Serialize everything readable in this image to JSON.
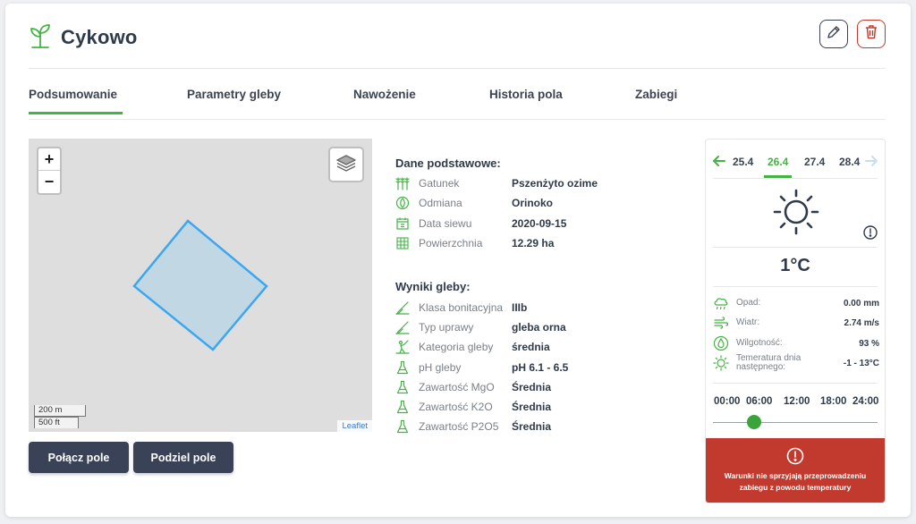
{
  "header": {
    "title": "Cykowo",
    "logo_icon": "sprout-icon"
  },
  "actions": {
    "edit_icon": "pencil-icon",
    "delete_icon": "trash-icon"
  },
  "tabs": [
    {
      "label": "Podsumowanie",
      "active": true
    },
    {
      "label": "Parametry gleby",
      "active": false
    },
    {
      "label": "Nawożenie",
      "active": false
    },
    {
      "label": "Historia pola",
      "active": false
    },
    {
      "label": "Zabiegi",
      "active": false
    }
  ],
  "map": {
    "zoom_in": "+",
    "zoom_out": "−",
    "scale_metric": "200 m",
    "scale_imperial": "500 ft",
    "attribution": "Leaflet"
  },
  "buttons": {
    "merge": "Połącz pole",
    "split": "Podziel pole"
  },
  "basic": {
    "title": "Dane podstawowe:",
    "rows": [
      {
        "label": "Gatunek",
        "value": "Pszenżyto ozime",
        "icon": "wheat-icon"
      },
      {
        "label": "Odmiana",
        "value": "Orinoko",
        "icon": "seed-icon"
      },
      {
        "label": "Data siewu",
        "value": "2020-09-15",
        "icon": "calendar-icon"
      },
      {
        "label": "Powierzchnia",
        "value": "12.29 ha",
        "icon": "area-grid-icon"
      }
    ]
  },
  "soil": {
    "title": "Wyniki gleby:",
    "rows": [
      {
        "label": "Klasa bonitacyjna",
        "value": "IIIb",
        "icon": "shovel-icon"
      },
      {
        "label": "Typ uprawy",
        "value": "gleba orna",
        "icon": "shovel-icon"
      },
      {
        "label": "Kategoria gleby",
        "value": "średnia",
        "icon": "digging-icon"
      },
      {
        "label": "pH gleby",
        "value": "pH 6.1 - 6.5",
        "icon": "flask-icon"
      },
      {
        "label": "Zawartość MgO",
        "value": "Średnia",
        "icon": "flask-icon"
      },
      {
        "label": "Zawartość K2O",
        "value": "Średnia",
        "icon": "flask-icon"
      },
      {
        "label": "Zawartość P2O5",
        "value": "Średnia",
        "icon": "flask-icon"
      }
    ]
  },
  "weather": {
    "days": [
      {
        "label": "25.4",
        "active": false
      },
      {
        "label": "26.4",
        "active": true
      },
      {
        "label": "27.4",
        "active": false
      },
      {
        "label": "28.4",
        "active": false
      }
    ],
    "temperature": "1°C",
    "rows": [
      {
        "label": "Opad:",
        "value": "0.00 mm",
        "icon": "rain-cloud-icon"
      },
      {
        "label": "Wiatr:",
        "value": "2.74 m/s",
        "icon": "wind-icon"
      },
      {
        "label": "Wilgotność:",
        "value": "93 %",
        "icon": "droplet-icon"
      },
      {
        "label": "Temeratura dnia następnego:",
        "value": "-1 - 13°C",
        "icon": "sun-small-icon"
      }
    ],
    "times": [
      "00:00",
      "06:00",
      "12:00",
      "18:00",
      "24:00"
    ],
    "slider_fraction": 0.25,
    "alert": "Warunki nie sprzyjają przeprowadzeniu zabiegu z powodu temperatury",
    "accent": "#44b344",
    "alert_color": "#c23a2e"
  }
}
